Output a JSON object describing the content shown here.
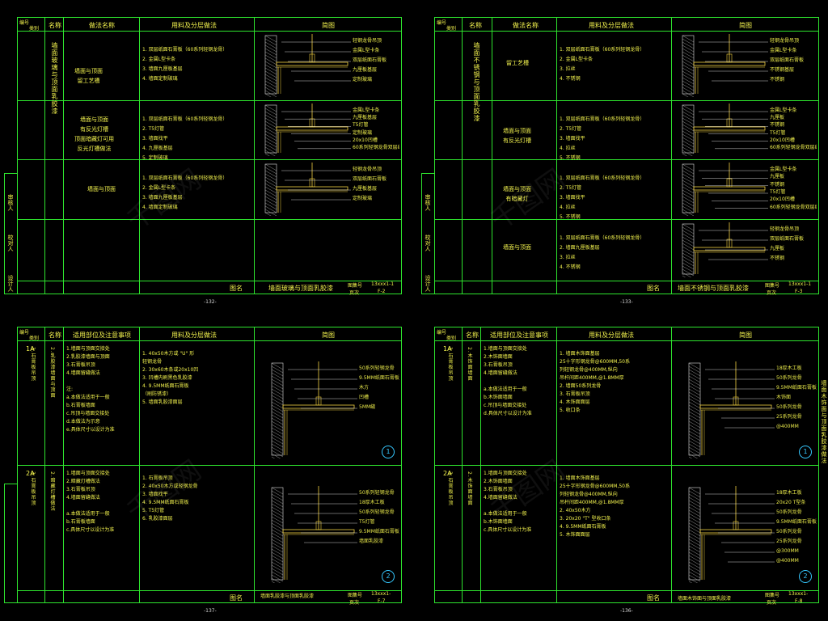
{
  "sheets": [
    {
      "id": "s1",
      "headers": {
        "num": "编号",
        "cat": "类别",
        "name": "名称",
        "method": "做法名称",
        "layers": "用料及分层做法",
        "fig": "简图"
      },
      "side_labels": [
        "审核人",
        "校对人",
        "设计人"
      ],
      "category_name": "墙面玻璃与顶面乳胶漆",
      "rows": [
        {
          "method": "墙面与顶面\n留工艺槽",
          "layers": [
            "1. 双层纸面石膏板（60系列轻钢龙骨）",
            "2. 金属L型卡条",
            "3. 墙面九厘板基层",
            "4. 墙面定制玻璃"
          ],
          "labels": [
            "轻钢龙骨吊顶",
            "金属L型卡条",
            "双层纸面石膏板",
            "九厘板基层",
            "定制玻璃"
          ]
        },
        {
          "method": "墙面与顶面\n有反光灯槽\n顶面暗藏灯可用\n反光灯槽做法",
          "layers": [
            "1. 双层纸面石膏板（60系列轻钢龙骨）",
            "2. T5灯管",
            "3. 墙面找平",
            "4. 九厘板基层",
            "5. 定制玻璃"
          ],
          "labels": [
            "金属L型卡条",
            "九厘板基层",
            "T5灯管",
            "定制玻璃",
            "20x10凹槽",
            "60系列轻钢龙骨双层纸面石膏板"
          ]
        },
        {
          "method": "墙面与顶面",
          "layers": [
            "1. 双层纸面石膏板（60系列轻钢龙骨）",
            "2. 金属L型卡条",
            "3. 墙面九厘板基层",
            "4. 墙面定制玻璃"
          ],
          "labels": [
            "轻钢龙骨吊顶",
            "双层纸面石膏板",
            "九厘板基层",
            "定制玻璃"
          ]
        }
      ],
      "footer": {
        "label": "图名",
        "title": "墙面玻璃与顶面乳胶漆",
        "code_label": "图集号",
        "code": "13xxx1-1",
        "page_label": "页次",
        "page": "F-2"
      },
      "page_num": "-132-"
    },
    {
      "id": "s2",
      "headers": {
        "num": "编号",
        "cat": "类别",
        "name": "名称",
        "method": "做法名称",
        "layers": "用料及分层做法",
        "fig": "简图"
      },
      "category_name": "墙面不锈钢与顶面乳胶漆",
      "rows": [
        {
          "method": "留工艺槽",
          "layers": [
            "1. 双层纸面石膏板（60系列轻钢龙骨）",
            "2. 金属L型卡条",
            "3. 拉丝",
            "4. 不锈钢"
          ],
          "labels": [
            "轻钢龙骨吊顶",
            "金属L型卡条",
            "双层纸面石膏板",
            "不锈钢基层",
            "不锈钢"
          ]
        },
        {
          "method": "墙面与顶面\n有反光灯槽",
          "layers": [
            "1. 双层纸面石膏板（60系列轻钢龙骨）",
            "2. T5灯管",
            "3. 墙面找平",
            "4. 拉丝",
            "5. 不锈钢"
          ],
          "labels": [
            "金属L型卡条",
            "九厘板",
            "不锈钢",
            "T5灯管",
            "20x10凹槽",
            "60系列轻钢龙骨双层纸面石膏板"
          ]
        },
        {
          "method": "墙面与顶面\n有暗藏灯",
          "layers": [
            "1. 双层纸面石膏板（60系列轻钢龙骨）",
            "2. T5灯管",
            "3. 墙面找平",
            "4. 拉丝",
            "5. 不锈钢"
          ],
          "labels": [
            "金属L型卡条",
            "九厘板",
            "不锈钢",
            "T5灯管",
            "20x10凹槽",
            "60系列轻钢龙骨双层纸面石膏板"
          ]
        },
        {
          "method": "墙面与顶面",
          "layers": [
            "1. 双层纸面石膏板（60系列轻钢龙骨）",
            "2. 墙面九厘板基层",
            "3. 拉丝",
            "4. 不锈钢"
          ],
          "labels": [
            "轻钢龙骨吊顶",
            "双层纸面石膏板",
            "九厘板",
            "不锈钢"
          ]
        }
      ],
      "footer": {
        "label": "图名",
        "title": "墙面不锈钢与顶面乳胶漆",
        "code_label": "图集号",
        "code": "13xxx1-1",
        "page_label": "页次",
        "page": "F-3"
      },
      "page_num": "-133-"
    },
    {
      "id": "s3",
      "headers": {
        "num": "编号",
        "cat": "类别",
        "name": "名称",
        "scope": "适用部位及注意事项",
        "layers": "用料及分层做法",
        "fig": "简图"
      },
      "rows": [
        {
          "code": "1A",
          "scope": [
            "1.墙面与顶面交接处",
            "2.乳胶漆墙面与顶面",
            "3.石膏板吊顶",
            "4.墙面留缝做法",
            "",
            "注:",
            "a.本做法适用于一般",
            "b.石膏板墙面",
            "c.吊顶与墙面交接处",
            "d.本做法为示意",
            "e.具体尺寸以设计为准"
          ],
          "layers": [
            "1. 40x50木方或 \"U\" 形",
            "   轻钢龙骨",
            "2. 30x60木条或20x10凹",
            "3. 凹槽内刷黑色乳胶漆",
            "4. 9.5MM纸面石膏板",
            "   （刷防锈漆）",
            "5. 墙面乳胶漆面层"
          ],
          "labels": [
            "50系列轻钢龙骨",
            "9.5MM纸面石膏板",
            "木方",
            "凹槽",
            "5MM缝"
          ],
          "circle": "1"
        },
        {
          "code": "2A",
          "scope": [
            "1.墙面与顶面交接处",
            "2.暗藏灯槽做法",
            "3.石膏板吊顶",
            "4.墙面留缝做法",
            "",
            "a.本做法适用于一般",
            "b.石膏板墙面",
            "c.具体尺寸以设计为准"
          ],
          "layers": [
            "1. 石膏板吊顶",
            "2. 40x50木方或轻钢龙骨",
            "3. 墙面找平",
            "4. 9.5MM纸面石膏板",
            "5. T5灯管",
            "6. 乳胶漆面层"
          ],
          "labels": [
            "50系列轻钢龙骨",
            "18厚木工板",
            "50系列轻钢龙骨",
            "T5灯管",
            "9.5MM纸面石膏板",
            "墙面乳胶漆"
          ],
          "circle": "2"
        }
      ],
      "footer": {
        "label": "图名",
        "title": "墙面乳胶漆与顶面乳胶漆",
        "code_label": "图集号",
        "code": "13xxx1-",
        "page_label": "页次",
        "page": "F-7"
      },
      "page_num": "-137-"
    },
    {
      "id": "s4",
      "headers": {
        "num": "编号",
        "cat": "类别",
        "name": "名称",
        "scope": "适用部位及注意事项",
        "layers": "用料及分层做法",
        "fig": "简图"
      },
      "rows": [
        {
          "code": "1A",
          "scope": [
            "1.墙面与顶面交接处",
            "2.木饰面墙面",
            "3.石膏板吊顶",
            "4.墙面留缝做法",
            "",
            "a.本做法适用于一般",
            "b.木饰面墙面",
            "c.吊顶与墙面交接处",
            "d.具体尺寸以设计为准"
          ],
          "layers": [
            "1. 墙面木饰面基层",
            "25十字形钢龙骨@600MM,50系",
            "列轻钢龙骨@400MM,纵向",
            "吊杆间距400MM,@1.8MM厚",
            "2. 墙面50系列龙骨",
            "3. 石膏板吊顶",
            "4. 木饰面面层",
            "5. 收口条"
          ],
          "labels": [
            "18厚木工板",
            "50系列龙骨",
            "9.5MM纸面石膏板",
            "木饰面",
            "50系列龙骨",
            "25系列龙骨",
            "@400MM"
          ],
          "circle": "1"
        },
        {
          "code": "2A",
          "scope": [
            "1.墙面与顶面交接处",
            "2.木饰面墙面",
            "3.石膏板吊顶",
            "4.墙面留缝做法",
            "",
            "a.本做法适用于一般",
            "b.木饰面墙面",
            "c.具体尺寸以设计为准"
          ],
          "layers": [
            "1. 墙面木饰面基层",
            "25十字形钢龙骨@600MM,50系",
            "列轻钢龙骨@400MM,纵向",
            "吊杆间距400MM,@1.8MM厚",
            "2. 40x50木方",
            "3. 20x20 \"T\" 型收口条",
            "4. 9.5MM纸面石膏板",
            "5. 木饰面面层"
          ],
          "labels": [
            "18厚木工板",
            "20x20 T型条",
            "50系列龙骨",
            "9.5MM纸面石膏板",
            "50系列龙骨",
            "25系列龙骨",
            "@300MM",
            "@400MM"
          ],
          "circle": "2"
        }
      ],
      "side_category": "墙面木饰面与顶面乳胶漆做法",
      "footer": {
        "label": "图名",
        "title": "墙面木饰面与顶面乳胶漆",
        "code_label": "图集号",
        "code": "13xxx1-",
        "page_label": "页次",
        "page": "F-8"
      },
      "page_num": "-136-"
    }
  ],
  "watermark": "千图网"
}
